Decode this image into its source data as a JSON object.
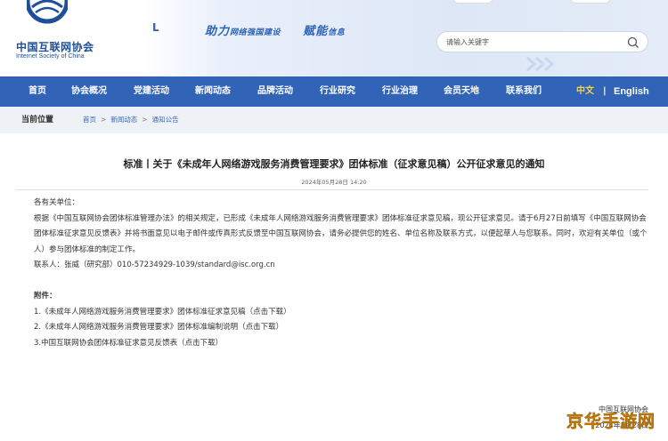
{
  "header": {
    "logo_cn": "中国互联网协会",
    "logo_en": "Internet Society of China",
    "slogan_big_1": "助力",
    "slogan_small_1": "网络强国建设",
    "slogan_big_2": "赋能",
    "slogan_small_2": "信息",
    "search_placeholder": "请输入关键字",
    "colors": {
      "primary": "#3164b7",
      "brand": "#1f4f99",
      "lang_active": "#f7d24a"
    }
  },
  "nav": {
    "items": [
      "首页",
      "协会概况",
      "党建活动",
      "新闻动态",
      "品牌活动",
      "行业研究",
      "行业治理",
      "会员天地",
      "联系我们"
    ],
    "lang_zh": "中文",
    "lang_sep": "|",
    "lang_en": "English"
  },
  "breadcrumb": {
    "title": "当前位置",
    "path": [
      "首页",
      "新闻动态",
      "通知公告"
    ],
    "separator": ">"
  },
  "article": {
    "title": "标准丨关于《未成年人网络游戏服务消费管理要求》团体标准（征求意见稿）公开征求意见的通知",
    "date": "2024年05月28日 14:20",
    "salutation": "各有关单位：",
    "para1": "根据《中国互联网协会团体标准管理办法》的相关规定，已形成《未成年人网络游戏服务消费管理要求》团体标准征求意见稿，现公开征求意见。请于6月27日前填写《中国互联网协会团体标准征求意见反馈表》并将书面意见以电子邮件或传真形式反馈至中国互联网协会，请务必提供您的姓名、单位名称及联系方式，以便起草人与您联系。同时，欢迎有关单位（或个人）参与团体标准的制定工作。",
    "contact": "联系人：张威（研究部）010-57234929-1039/standard@isc.org.cn",
    "attachments_heading": "附件：",
    "attachments": [
      "1.《未成年人网络游戏服务消费管理要求》团体标准征求意见稿（点击下载）",
      "2.《未成年人网络游戏服务消费管理要求》团体标准编制说明（点击下载）",
      "3.中国互联网协会团体标准征求意见反馈表（点击下载）"
    ],
    "signoff": "中国互联网协会",
    "sign_date": "2024年5月28日"
  },
  "watermark": {
    "text": "京华手游网"
  }
}
